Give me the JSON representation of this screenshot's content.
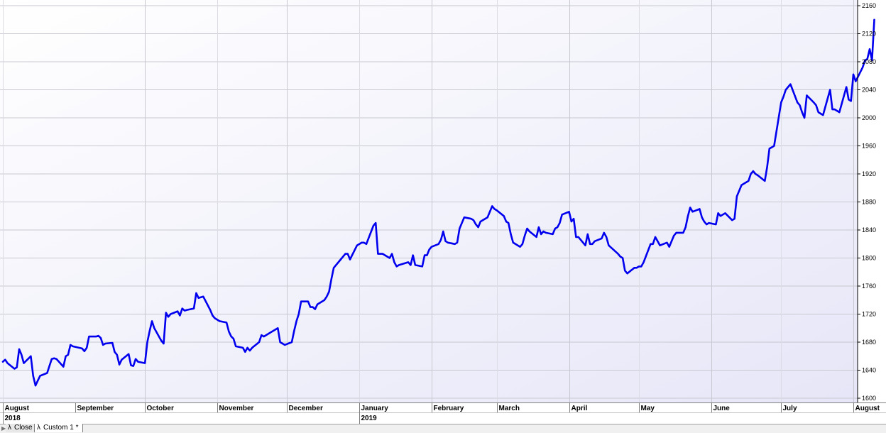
{
  "chart_data": {
    "type": "line",
    "title": "",
    "xlabel": "",
    "ylabel": "",
    "ylim": [
      1600,
      2160
    ],
    "y_ticks": [
      1600,
      1640,
      1680,
      1720,
      1760,
      1800,
      1840,
      1880,
      1920,
      1960,
      2000,
      2040,
      2080,
      2120,
      2160
    ],
    "x_range": [
      "2018-08-01",
      "2019-08-06"
    ],
    "month_ticks": [
      {
        "label": "August",
        "date": "2018-08-01"
      },
      {
        "label": "September",
        "date": "2018-09-01"
      },
      {
        "label": "October",
        "date": "2018-10-01"
      },
      {
        "label": "November",
        "date": "2018-11-01"
      },
      {
        "label": "December",
        "date": "2018-12-01"
      },
      {
        "label": "January",
        "date": "2019-01-01"
      },
      {
        "label": "February",
        "date": "2019-02-01"
      },
      {
        "label": "March",
        "date": "2019-03-01"
      },
      {
        "label": "April",
        "date": "2019-04-01"
      },
      {
        "label": "May",
        "date": "2019-05-01"
      },
      {
        "label": "June",
        "date": "2019-06-01"
      },
      {
        "label": "July",
        "date": "2019-07-01"
      },
      {
        "label": "August",
        "date": "2019-08-01"
      }
    ],
    "year_ticks": [
      {
        "label": "2018",
        "date": "2018-08-01"
      },
      {
        "label": "2019",
        "date": "2019-01-01"
      }
    ],
    "grid": true,
    "line_color": "#0000ee",
    "series": [
      {
        "values": [
          [
            "2018-08-01",
            1652
          ],
          [
            "2018-08-02",
            1655
          ],
          [
            "2018-08-03",
            1650
          ],
          [
            "2018-08-06",
            1642
          ],
          [
            "2018-08-07",
            1644
          ],
          [
            "2018-08-08",
            1670
          ],
          [
            "2018-08-09",
            1662
          ],
          [
            "2018-08-10",
            1650
          ],
          [
            "2018-08-13",
            1660
          ],
          [
            "2018-08-14",
            1632
          ],
          [
            "2018-08-15",
            1618
          ],
          [
            "2018-08-16",
            1625
          ],
          [
            "2018-08-17",
            1632
          ],
          [
            "2018-08-20",
            1636
          ],
          [
            "2018-08-21",
            1646
          ],
          [
            "2018-08-22",
            1656
          ],
          [
            "2018-08-23",
            1657
          ],
          [
            "2018-08-24",
            1656
          ],
          [
            "2018-08-27",
            1645
          ],
          [
            "2018-08-28",
            1660
          ],
          [
            "2018-08-29",
            1662
          ],
          [
            "2018-08-30",
            1676
          ],
          [
            "2018-08-31",
            1674
          ],
          [
            "2018-09-04",
            1671
          ],
          [
            "2018-09-05",
            1667
          ],
          [
            "2018-09-06",
            1672
          ],
          [
            "2018-09-07",
            1688
          ],
          [
            "2018-09-10",
            1688
          ],
          [
            "2018-09-11",
            1689
          ],
          [
            "2018-09-12",
            1686
          ],
          [
            "2018-09-13",
            1676
          ],
          [
            "2018-09-14",
            1678
          ],
          [
            "2018-09-17",
            1679
          ],
          [
            "2018-09-18",
            1666
          ],
          [
            "2018-09-19",
            1662
          ],
          [
            "2018-09-20",
            1648
          ],
          [
            "2018-09-21",
            1655
          ],
          [
            "2018-09-24",
            1663
          ],
          [
            "2018-09-25",
            1647
          ],
          [
            "2018-09-26",
            1646
          ],
          [
            "2018-09-27",
            1656
          ],
          [
            "2018-09-28",
            1652
          ],
          [
            "2018-10-01",
            1650
          ],
          [
            "2018-10-02",
            1680
          ],
          [
            "2018-10-03",
            1696
          ],
          [
            "2018-10-04",
            1710
          ],
          [
            "2018-10-05",
            1700
          ],
          [
            "2018-10-08",
            1682
          ],
          [
            "2018-10-09",
            1678
          ],
          [
            "2018-10-10",
            1722
          ],
          [
            "2018-10-11",
            1716
          ],
          [
            "2018-10-12",
            1720
          ],
          [
            "2018-10-15",
            1724
          ],
          [
            "2018-10-16",
            1718
          ],
          [
            "2018-10-17",
            1728
          ],
          [
            "2018-10-18",
            1725
          ],
          [
            "2018-10-19",
            1726
          ],
          [
            "2018-10-22",
            1728
          ],
          [
            "2018-10-23",
            1750
          ],
          [
            "2018-10-24",
            1743
          ],
          [
            "2018-10-25",
            1744
          ],
          [
            "2018-10-26",
            1745
          ],
          [
            "2018-10-29",
            1726
          ],
          [
            "2018-10-30",
            1718
          ],
          [
            "2018-10-31",
            1714
          ],
          [
            "2018-11-01",
            1712
          ],
          [
            "2018-11-02",
            1710
          ],
          [
            "2018-11-05",
            1708
          ],
          [
            "2018-11-06",
            1695
          ],
          [
            "2018-11-07",
            1688
          ],
          [
            "2018-11-08",
            1685
          ],
          [
            "2018-11-09",
            1674
          ],
          [
            "2018-11-12",
            1672
          ],
          [
            "2018-11-13",
            1666
          ],
          [
            "2018-11-14",
            1672
          ],
          [
            "2018-11-15",
            1668
          ],
          [
            "2018-11-16",
            1672
          ],
          [
            "2018-11-19",
            1680
          ],
          [
            "2018-11-20",
            1690
          ],
          [
            "2018-11-21",
            1688
          ],
          [
            "2018-11-23",
            1692
          ],
          [
            "2018-11-26",
            1698
          ],
          [
            "2018-11-27",
            1700
          ],
          [
            "2018-11-28",
            1680
          ],
          [
            "2018-11-29",
            1678
          ],
          [
            "2018-11-30",
            1676
          ],
          [
            "2018-12-03",
            1680
          ],
          [
            "2018-12-04",
            1696
          ],
          [
            "2018-12-05",
            1710
          ],
          [
            "2018-12-06",
            1720
          ],
          [
            "2018-12-07",
            1738
          ],
          [
            "2018-12-10",
            1738
          ],
          [
            "2018-12-11",
            1730
          ],
          [
            "2018-12-12",
            1730
          ],
          [
            "2018-12-13",
            1727
          ],
          [
            "2018-12-14",
            1734
          ],
          [
            "2018-12-17",
            1740
          ],
          [
            "2018-12-18",
            1745
          ],
          [
            "2018-12-19",
            1752
          ],
          [
            "2018-12-20",
            1770
          ],
          [
            "2018-12-21",
            1786
          ],
          [
            "2018-12-24",
            1798
          ],
          [
            "2018-12-26",
            1806
          ],
          [
            "2018-12-27",
            1806
          ],
          [
            "2018-12-28",
            1798
          ],
          [
            "2018-12-31",
            1818
          ],
          [
            "2019-01-02",
            1822
          ],
          [
            "2019-01-03",
            1822
          ],
          [
            "2019-01-04",
            1820
          ],
          [
            "2019-01-07",
            1846
          ],
          [
            "2019-01-08",
            1850
          ],
          [
            "2019-01-09",
            1806
          ],
          [
            "2019-01-10",
            1806
          ],
          [
            "2019-01-11",
            1806
          ],
          [
            "2019-01-14",
            1800
          ],
          [
            "2019-01-15",
            1806
          ],
          [
            "2019-01-16",
            1794
          ],
          [
            "2019-01-17",
            1788
          ],
          [
            "2019-01-18",
            1790
          ],
          [
            "2019-01-22",
            1794
          ],
          [
            "2019-01-23",
            1790
          ],
          [
            "2019-01-24",
            1804
          ],
          [
            "2019-01-25",
            1790
          ],
          [
            "2019-01-28",
            1788
          ],
          [
            "2019-01-29",
            1804
          ],
          [
            "2019-01-30",
            1804
          ],
          [
            "2019-01-31",
            1812
          ],
          [
            "2019-02-01",
            1816
          ],
          [
            "2019-02-04",
            1820
          ],
          [
            "2019-02-05",
            1826
          ],
          [
            "2019-02-06",
            1838
          ],
          [
            "2019-02-07",
            1824
          ],
          [
            "2019-02-08",
            1822
          ],
          [
            "2019-02-11",
            1820
          ],
          [
            "2019-02-12",
            1822
          ],
          [
            "2019-02-13",
            1842
          ],
          [
            "2019-02-14",
            1850
          ],
          [
            "2019-02-15",
            1858
          ],
          [
            "2019-02-18",
            1856
          ],
          [
            "2019-02-19",
            1854
          ],
          [
            "2019-02-20",
            1848
          ],
          [
            "2019-02-21",
            1844
          ],
          [
            "2019-02-22",
            1852
          ],
          [
            "2019-02-25",
            1858
          ],
          [
            "2019-02-26",
            1866
          ],
          [
            "2019-02-27",
            1874
          ],
          [
            "2019-02-28",
            1870
          ],
          [
            "2019-03-01",
            1868
          ],
          [
            "2019-03-04",
            1860
          ],
          [
            "2019-03-05",
            1852
          ],
          [
            "2019-03-06",
            1850
          ],
          [
            "2019-03-07",
            1834
          ],
          [
            "2019-03-08",
            1822
          ],
          [
            "2019-03-11",
            1816
          ],
          [
            "2019-03-12",
            1820
          ],
          [
            "2019-03-13",
            1832
          ],
          [
            "2019-03-14",
            1842
          ],
          [
            "2019-03-15",
            1838
          ],
          [
            "2019-03-18",
            1830
          ],
          [
            "2019-03-19",
            1844
          ],
          [
            "2019-03-20",
            1834
          ],
          [
            "2019-03-21",
            1838
          ],
          [
            "2019-03-22",
            1836
          ],
          [
            "2019-03-25",
            1834
          ],
          [
            "2019-03-26",
            1842
          ],
          [
            "2019-03-27",
            1844
          ],
          [
            "2019-03-28",
            1850
          ],
          [
            "2019-03-29",
            1862
          ],
          [
            "2019-04-01",
            1866
          ],
          [
            "2019-04-02",
            1852
          ],
          [
            "2019-04-03",
            1856
          ],
          [
            "2019-04-04",
            1830
          ],
          [
            "2019-04-05",
            1830
          ],
          [
            "2019-04-08",
            1818
          ],
          [
            "2019-04-09",
            1834
          ],
          [
            "2019-04-10",
            1820
          ],
          [
            "2019-04-11",
            1820
          ],
          [
            "2019-04-12",
            1824
          ],
          [
            "2019-04-15",
            1828
          ],
          [
            "2019-04-16",
            1836
          ],
          [
            "2019-04-17",
            1830
          ],
          [
            "2019-04-18",
            1818
          ],
          [
            "2019-04-22",
            1806
          ],
          [
            "2019-04-23",
            1802
          ],
          [
            "2019-04-24",
            1800
          ],
          [
            "2019-04-25",
            1782
          ],
          [
            "2019-04-26",
            1778
          ],
          [
            "2019-04-29",
            1786
          ],
          [
            "2019-04-30",
            1786
          ],
          [
            "2019-05-01",
            1788
          ],
          [
            "2019-05-02",
            1788
          ],
          [
            "2019-05-03",
            1794
          ],
          [
            "2019-05-06",
            1820
          ],
          [
            "2019-05-07",
            1820
          ],
          [
            "2019-05-08",
            1830
          ],
          [
            "2019-05-09",
            1824
          ],
          [
            "2019-05-10",
            1818
          ],
          [
            "2019-05-13",
            1822
          ],
          [
            "2019-05-14",
            1816
          ],
          [
            "2019-05-15",
            1824
          ],
          [
            "2019-05-16",
            1832
          ],
          [
            "2019-05-17",
            1836
          ],
          [
            "2019-05-20",
            1836
          ],
          [
            "2019-05-21",
            1844
          ],
          [
            "2019-05-22",
            1860
          ],
          [
            "2019-05-23",
            1872
          ],
          [
            "2019-05-24",
            1866
          ],
          [
            "2019-05-27",
            1870
          ],
          [
            "2019-05-28",
            1858
          ],
          [
            "2019-05-29",
            1852
          ],
          [
            "2019-05-30",
            1848
          ],
          [
            "2019-05-31",
            1850
          ],
          [
            "2019-06-03",
            1848
          ],
          [
            "2019-06-04",
            1864
          ],
          [
            "2019-06-05",
            1860
          ],
          [
            "2019-06-06",
            1862
          ],
          [
            "2019-06-07",
            1864
          ],
          [
            "2019-06-10",
            1854
          ],
          [
            "2019-06-11",
            1856
          ],
          [
            "2019-06-12",
            1888
          ],
          [
            "2019-06-13",
            1896
          ],
          [
            "2019-06-14",
            1904
          ],
          [
            "2019-06-17",
            1910
          ],
          [
            "2019-06-18",
            1920
          ],
          [
            "2019-06-19",
            1924
          ],
          [
            "2019-06-20",
            1920
          ],
          [
            "2019-06-21",
            1918
          ],
          [
            "2019-06-24",
            1910
          ],
          [
            "2019-06-25",
            1930
          ],
          [
            "2019-06-26",
            1956
          ],
          [
            "2019-06-27",
            1958
          ],
          [
            "2019-06-28",
            1960
          ],
          [
            "2019-07-01",
            2022
          ],
          [
            "2019-07-02",
            2030
          ],
          [
            "2019-07-03",
            2040
          ],
          [
            "2019-07-05",
            2048
          ],
          [
            "2019-07-08",
            2022
          ],
          [
            "2019-07-09",
            2018
          ],
          [
            "2019-07-10",
            2008
          ],
          [
            "2019-07-11",
            2000
          ],
          [
            "2019-07-12",
            2032
          ],
          [
            "2019-07-15",
            2022
          ],
          [
            "2019-07-16",
            2018
          ],
          [
            "2019-07-17",
            2008
          ],
          [
            "2019-07-18",
            2006
          ],
          [
            "2019-07-19",
            2004
          ],
          [
            "2019-07-22",
            2040
          ],
          [
            "2019-07-23",
            2012
          ],
          [
            "2019-07-24",
            2012
          ],
          [
            "2019-07-25",
            2010
          ],
          [
            "2019-07-26",
            2008
          ],
          [
            "2019-07-29",
            2044
          ],
          [
            "2019-07-30",
            2026
          ],
          [
            "2019-07-31",
            2024
          ],
          [
            "2019-08-01",
            2062
          ],
          [
            "2019-08-02",
            2052
          ],
          [
            "2019-08-05",
            2072
          ],
          [
            "2019-08-06",
            2082
          ],
          [
            "2019-08-07",
            2084
          ],
          [
            "2019-08-08",
            2098
          ],
          [
            "2019-08-09",
            2082
          ],
          [
            "2019-08-10",
            2140
          ]
        ]
      }
    ]
  },
  "tabs": [
    {
      "label": "Close"
    },
    {
      "label": "Custom 1 *"
    }
  ]
}
